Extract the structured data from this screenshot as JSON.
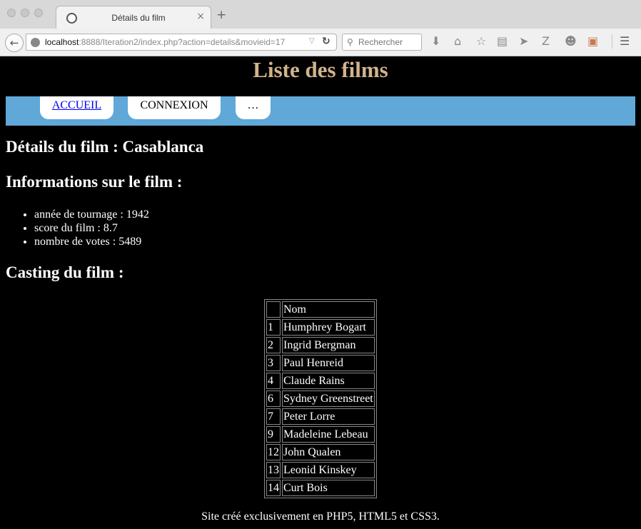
{
  "browser": {
    "tab_title": "Détails du film",
    "tab_close": "×",
    "new_tab": "+",
    "url_host": "localhost",
    "url_rest": ":8888/Iteration2/index.php?action=details&movieid=17",
    "search_placeholder": "Rechercher"
  },
  "site": {
    "title": "Liste des films",
    "nav": {
      "home": "ACCUEIL",
      "login": "CONNEXION",
      "more": "…"
    }
  },
  "movie": {
    "heading": "Détails du film : Casablanca",
    "info_heading": "Informations sur le film :",
    "info": [
      "année de tournage : 1942",
      "score du film : 8.7",
      "nombre de votes : 5489"
    ],
    "cast_heading": "Casting du film :",
    "cast_header": [
      "",
      "Nom"
    ],
    "cast": [
      {
        "n": "1",
        "name": "Humphrey Bogart"
      },
      {
        "n": "2",
        "name": "Ingrid Bergman"
      },
      {
        "n": "3",
        "name": "Paul Henreid"
      },
      {
        "n": "4",
        "name": "Claude Rains"
      },
      {
        "n": "6",
        "name": "Sydney Greenstreet"
      },
      {
        "n": "7",
        "name": "Peter Lorre"
      },
      {
        "n": "9",
        "name": "Madeleine Lebeau"
      },
      {
        "n": "12",
        "name": "John Qualen"
      },
      {
        "n": "13",
        "name": "Leonid Kinskey"
      },
      {
        "n": "14",
        "name": "Curt Bois"
      }
    ]
  },
  "footer": "Site créé exclusivement en PHP5, HTML5 et CSS3.",
  "colors": {
    "title": "#d2b48c",
    "nav_bar": "#5fa8d8",
    "link": "#0000ee"
  }
}
